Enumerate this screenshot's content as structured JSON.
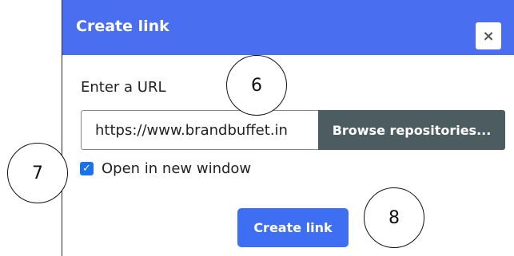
{
  "dialog": {
    "title": "Create link",
    "close_label": "×",
    "url_label": "Enter a URL",
    "url_value": "https://www.brandbuffet.in",
    "browse_label": "Browse repositories...",
    "open_new_window_label": "Open in new window",
    "open_new_window_checked": true,
    "checkmark": "✓",
    "create_label": "Create link"
  },
  "markers": [
    "6",
    "7",
    "8"
  ],
  "colors": {
    "header": "#4a6ef0",
    "browse_button": "#4c5c61",
    "create_button": "#3e6ff3",
    "checkbox": "#1a73e8"
  }
}
